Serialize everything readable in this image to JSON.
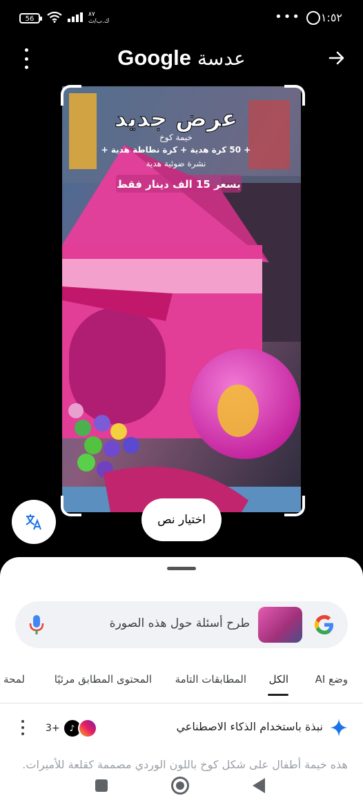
{
  "status_bar": {
    "time": "١:٥٢",
    "battery": "56",
    "speed_value": "٨٧",
    "speed_unit": "ك.ب/ث"
  },
  "header": {
    "title_brand": "Google",
    "title_word": "عدسة",
    "menu_icon": "more-vert-icon",
    "back_icon": "arrow-right-icon"
  },
  "image_overlay": {
    "headline": "عرض جديد",
    "line1": "خيمة كوخ",
    "line2": "+ 50 كرة هدية + كرة نطاطة هدية +",
    "line3": "نشرة ضوئية هدية",
    "price_line": "بسعر 15 الف دينار فقط"
  },
  "actions": {
    "translate_icon": "translate-icon",
    "select_text_label": "اختيار نص"
  },
  "search": {
    "placeholder": "طرح أسئلة حول هذه الصورة"
  },
  "tabs": [
    {
      "label": "وضع AI"
    },
    {
      "label": "الكل"
    },
    {
      "label": "المطابقات التامة"
    },
    {
      "label": "المحتوى المطابق مرئيًا"
    },
    {
      "label": "لمحة ع"
    }
  ],
  "ai_overview": {
    "title": "نبذة باستخدام الذكاء الاصطناعي",
    "sources_count": "3+",
    "text": "هذه خيمة أطفال على شكل كوخ باللون الوردي مصممة كقلعة للأميرات."
  },
  "colors": {
    "accent_blue": "#1a73e8",
    "sheet_bg": "#ffffff",
    "search_bg": "#f0f2f5",
    "tent_pink": "#e0409a"
  }
}
